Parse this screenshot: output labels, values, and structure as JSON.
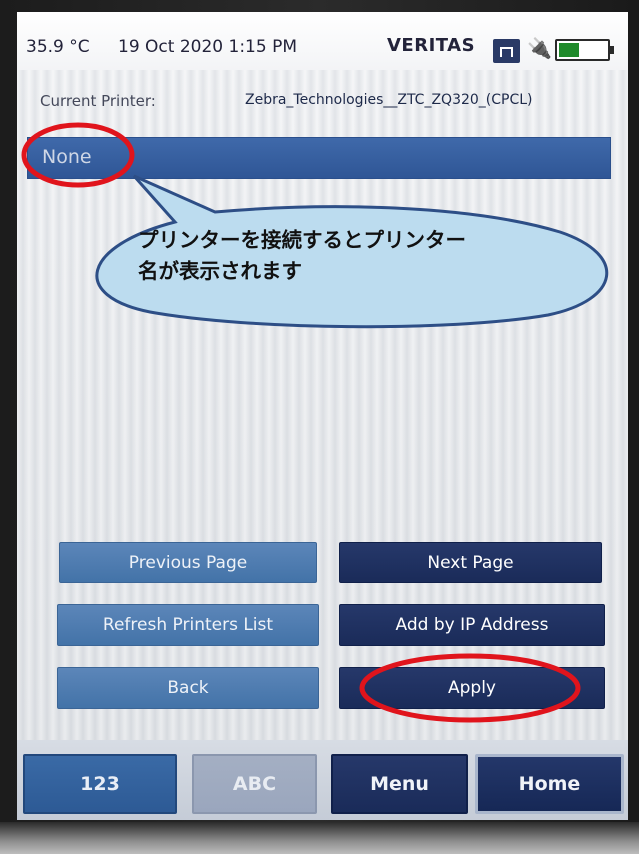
{
  "status": {
    "temperature": "35.9 °C",
    "datetime": "19 Oct 2020 1:15 PM",
    "brand": "VERITAS"
  },
  "printer": {
    "label": "Current Printer:",
    "current": "Zebra_Technologies__ZTC_ZQ320_(CPCL)",
    "selected_row": "None"
  },
  "callout": {
    "text_line1": "プリンターを接続するとプリンター",
    "text_line2": "名が表示されます"
  },
  "buttons": {
    "previous_page": "Previous Page",
    "next_page": "Next Page",
    "refresh": "Refresh Printers List",
    "add_ip": "Add by IP Address",
    "back": "Back",
    "apply": "Apply"
  },
  "tabs": {
    "numeric": "123",
    "alpha": "ABC",
    "menu": "Menu",
    "home": "Home"
  },
  "colors": {
    "highlight_ellipse": "#e0141c",
    "balloon_fill": "#bcdcef",
    "balloon_stroke": "#2d4e86",
    "battery_fill": "#1f8a2a"
  },
  "icons": [
    "network-icon",
    "plug-icon",
    "battery-icon"
  ]
}
